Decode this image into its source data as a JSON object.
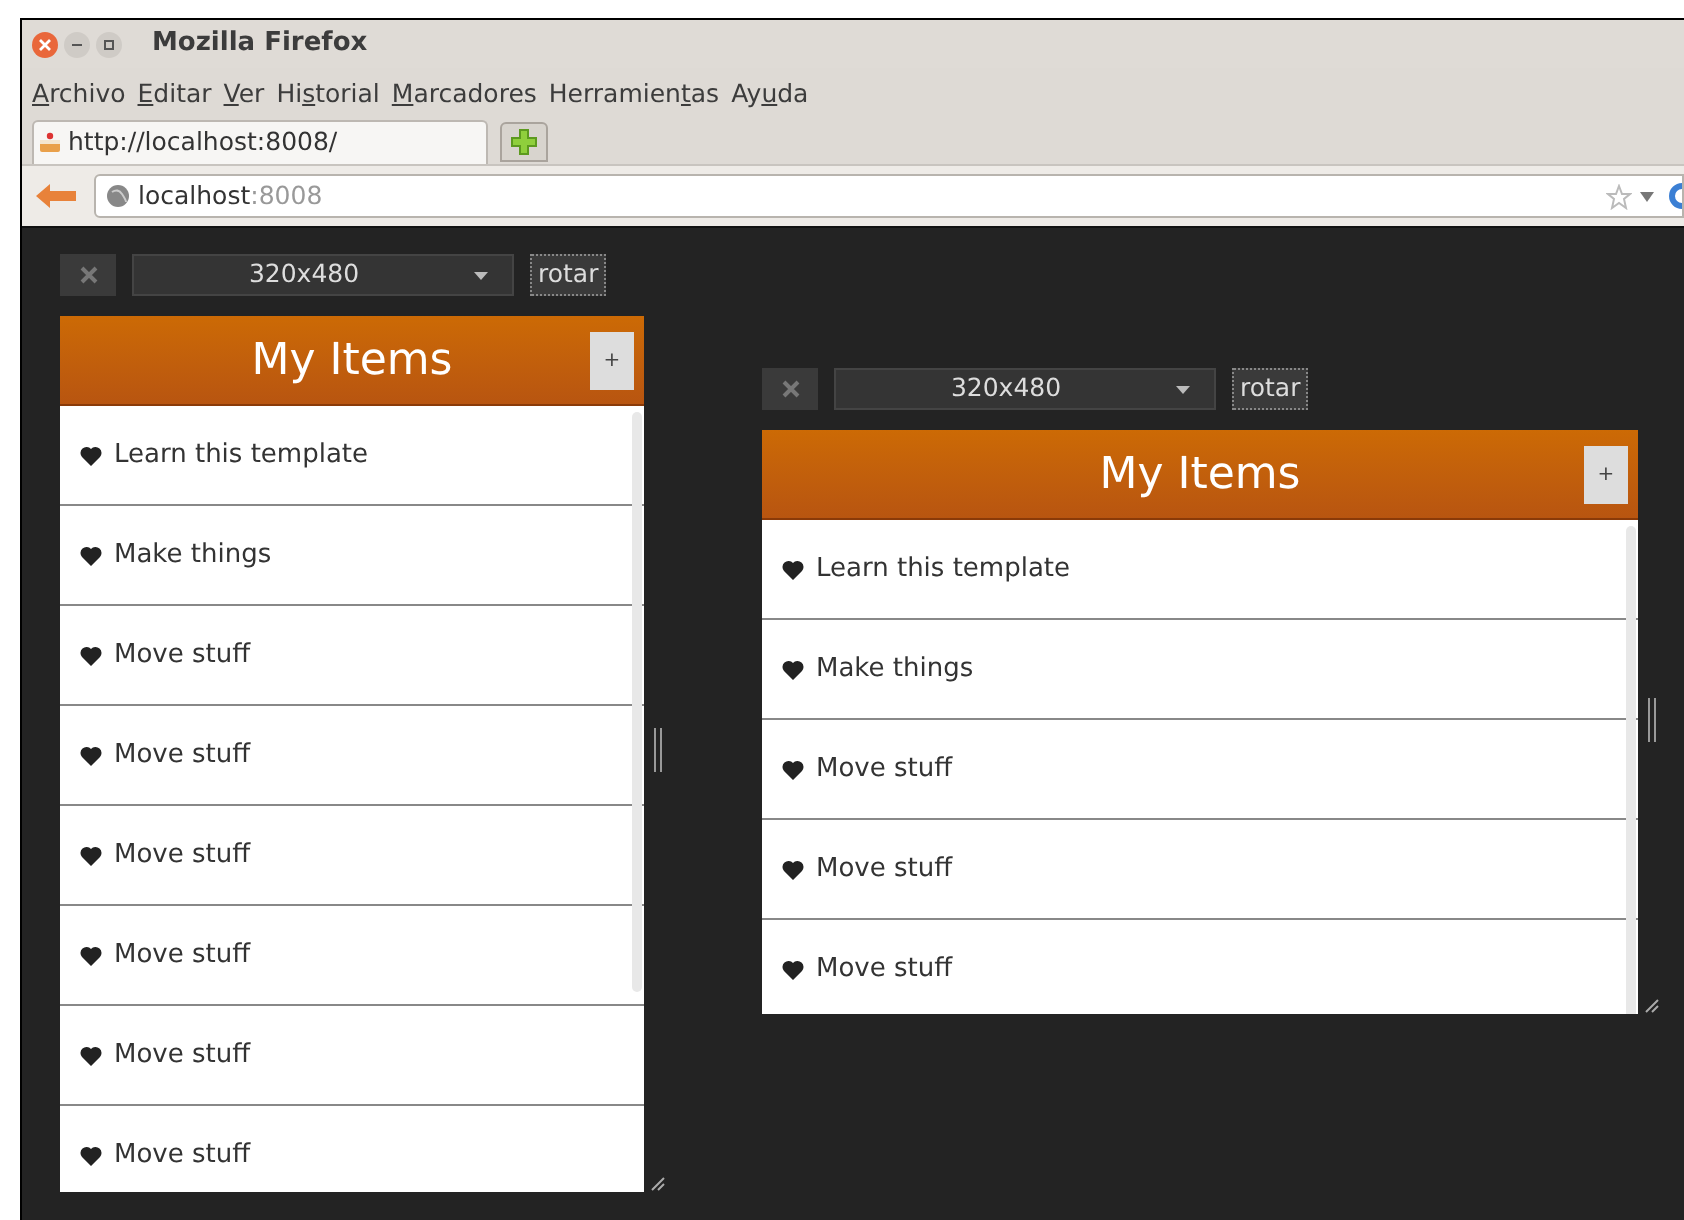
{
  "window": {
    "title": "Mozilla Firefox"
  },
  "menu": [
    {
      "key": "A",
      "after": "rchivo"
    },
    {
      "key": "E",
      "after": "ditar"
    },
    {
      "key": "V",
      "after": "er"
    },
    {
      "before": "Hi",
      "key": "s",
      "after": "torial"
    },
    {
      "key": "M",
      "after": "arcadores"
    },
    {
      "before": "Herramien",
      "key": "t",
      "after": "as"
    },
    {
      "before": "Ay",
      "key": "u",
      "after": "da"
    }
  ],
  "tabs": [
    {
      "label": "http://localhost:8008/",
      "selected": true
    }
  ],
  "address": {
    "host": "localhost",
    "rest": ":8008"
  },
  "emulators": [
    {
      "size": "320x480",
      "rotate": "rotar",
      "app": {
        "title": "My Items",
        "add": "+",
        "items": [
          "Learn this template",
          "Make things",
          "Move stuff",
          "Move stuff",
          "Move stuff",
          "Move stuff",
          "Move stuff",
          "Move stuff"
        ]
      }
    },
    {
      "size": "320x480",
      "rotate": "rotar",
      "app": {
        "title": "My Items",
        "add": "+",
        "items": [
          "Learn this template",
          "Make things",
          "Move stuff",
          "Move stuff",
          "Move stuff"
        ]
      }
    }
  ]
}
